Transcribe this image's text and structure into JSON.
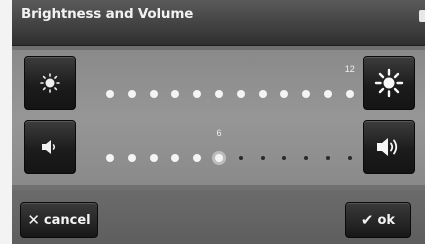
{
  "window": {
    "title": "Brightness and Volume"
  },
  "brightness": {
    "level_label": "12",
    "value": 12,
    "max": 12,
    "decrease_icon": "brightness-low-icon",
    "increase_icon": "brightness-high-icon"
  },
  "volume": {
    "level_label": "6",
    "value": 6,
    "max": 12,
    "decrease_icon": "speaker-low-icon",
    "increase_icon": "speaker-high-icon"
  },
  "actions": {
    "cancel_label": "cancel",
    "ok_label": "ok",
    "cancel_icon": "x-icon",
    "ok_icon": "checkmark-icon"
  }
}
